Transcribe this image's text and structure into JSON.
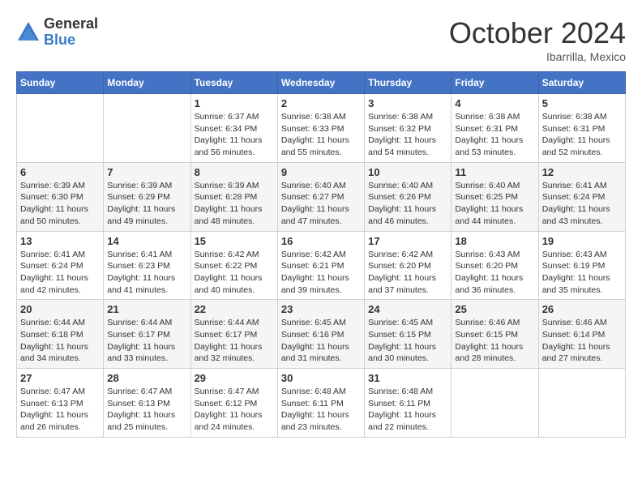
{
  "logo": {
    "general": "General",
    "blue": "Blue"
  },
  "title": {
    "month": "October 2024",
    "location": "Ibarrilla, Mexico"
  },
  "headers": [
    "Sunday",
    "Monday",
    "Tuesday",
    "Wednesday",
    "Thursday",
    "Friday",
    "Saturday"
  ],
  "weeks": [
    [
      {
        "day": "",
        "info": ""
      },
      {
        "day": "",
        "info": ""
      },
      {
        "day": "1",
        "info": "Sunrise: 6:37 AM\nSunset: 6:34 PM\nDaylight: 11 hours and 56 minutes."
      },
      {
        "day": "2",
        "info": "Sunrise: 6:38 AM\nSunset: 6:33 PM\nDaylight: 11 hours and 55 minutes."
      },
      {
        "day": "3",
        "info": "Sunrise: 6:38 AM\nSunset: 6:32 PM\nDaylight: 11 hours and 54 minutes."
      },
      {
        "day": "4",
        "info": "Sunrise: 6:38 AM\nSunset: 6:31 PM\nDaylight: 11 hours and 53 minutes."
      },
      {
        "day": "5",
        "info": "Sunrise: 6:38 AM\nSunset: 6:31 PM\nDaylight: 11 hours and 52 minutes."
      }
    ],
    [
      {
        "day": "6",
        "info": "Sunrise: 6:39 AM\nSunset: 6:30 PM\nDaylight: 11 hours and 50 minutes."
      },
      {
        "day": "7",
        "info": "Sunrise: 6:39 AM\nSunset: 6:29 PM\nDaylight: 11 hours and 49 minutes."
      },
      {
        "day": "8",
        "info": "Sunrise: 6:39 AM\nSunset: 6:28 PM\nDaylight: 11 hours and 48 minutes."
      },
      {
        "day": "9",
        "info": "Sunrise: 6:40 AM\nSunset: 6:27 PM\nDaylight: 11 hours and 47 minutes."
      },
      {
        "day": "10",
        "info": "Sunrise: 6:40 AM\nSunset: 6:26 PM\nDaylight: 11 hours and 46 minutes."
      },
      {
        "day": "11",
        "info": "Sunrise: 6:40 AM\nSunset: 6:25 PM\nDaylight: 11 hours and 44 minutes."
      },
      {
        "day": "12",
        "info": "Sunrise: 6:41 AM\nSunset: 6:24 PM\nDaylight: 11 hours and 43 minutes."
      }
    ],
    [
      {
        "day": "13",
        "info": "Sunrise: 6:41 AM\nSunset: 6:24 PM\nDaylight: 11 hours and 42 minutes."
      },
      {
        "day": "14",
        "info": "Sunrise: 6:41 AM\nSunset: 6:23 PM\nDaylight: 11 hours and 41 minutes."
      },
      {
        "day": "15",
        "info": "Sunrise: 6:42 AM\nSunset: 6:22 PM\nDaylight: 11 hours and 40 minutes."
      },
      {
        "day": "16",
        "info": "Sunrise: 6:42 AM\nSunset: 6:21 PM\nDaylight: 11 hours and 39 minutes."
      },
      {
        "day": "17",
        "info": "Sunrise: 6:42 AM\nSunset: 6:20 PM\nDaylight: 11 hours and 37 minutes."
      },
      {
        "day": "18",
        "info": "Sunrise: 6:43 AM\nSunset: 6:20 PM\nDaylight: 11 hours and 36 minutes."
      },
      {
        "day": "19",
        "info": "Sunrise: 6:43 AM\nSunset: 6:19 PM\nDaylight: 11 hours and 35 minutes."
      }
    ],
    [
      {
        "day": "20",
        "info": "Sunrise: 6:44 AM\nSunset: 6:18 PM\nDaylight: 11 hours and 34 minutes."
      },
      {
        "day": "21",
        "info": "Sunrise: 6:44 AM\nSunset: 6:17 PM\nDaylight: 11 hours and 33 minutes."
      },
      {
        "day": "22",
        "info": "Sunrise: 6:44 AM\nSunset: 6:17 PM\nDaylight: 11 hours and 32 minutes."
      },
      {
        "day": "23",
        "info": "Sunrise: 6:45 AM\nSunset: 6:16 PM\nDaylight: 11 hours and 31 minutes."
      },
      {
        "day": "24",
        "info": "Sunrise: 6:45 AM\nSunset: 6:15 PM\nDaylight: 11 hours and 30 minutes."
      },
      {
        "day": "25",
        "info": "Sunrise: 6:46 AM\nSunset: 6:15 PM\nDaylight: 11 hours and 28 minutes."
      },
      {
        "day": "26",
        "info": "Sunrise: 6:46 AM\nSunset: 6:14 PM\nDaylight: 11 hours and 27 minutes."
      }
    ],
    [
      {
        "day": "27",
        "info": "Sunrise: 6:47 AM\nSunset: 6:13 PM\nDaylight: 11 hours and 26 minutes."
      },
      {
        "day": "28",
        "info": "Sunrise: 6:47 AM\nSunset: 6:13 PM\nDaylight: 11 hours and 25 minutes."
      },
      {
        "day": "29",
        "info": "Sunrise: 6:47 AM\nSunset: 6:12 PM\nDaylight: 11 hours and 24 minutes."
      },
      {
        "day": "30",
        "info": "Sunrise: 6:48 AM\nSunset: 6:11 PM\nDaylight: 11 hours and 23 minutes."
      },
      {
        "day": "31",
        "info": "Sunrise: 6:48 AM\nSunset: 6:11 PM\nDaylight: 11 hours and 22 minutes."
      },
      {
        "day": "",
        "info": ""
      },
      {
        "day": "",
        "info": ""
      }
    ]
  ]
}
